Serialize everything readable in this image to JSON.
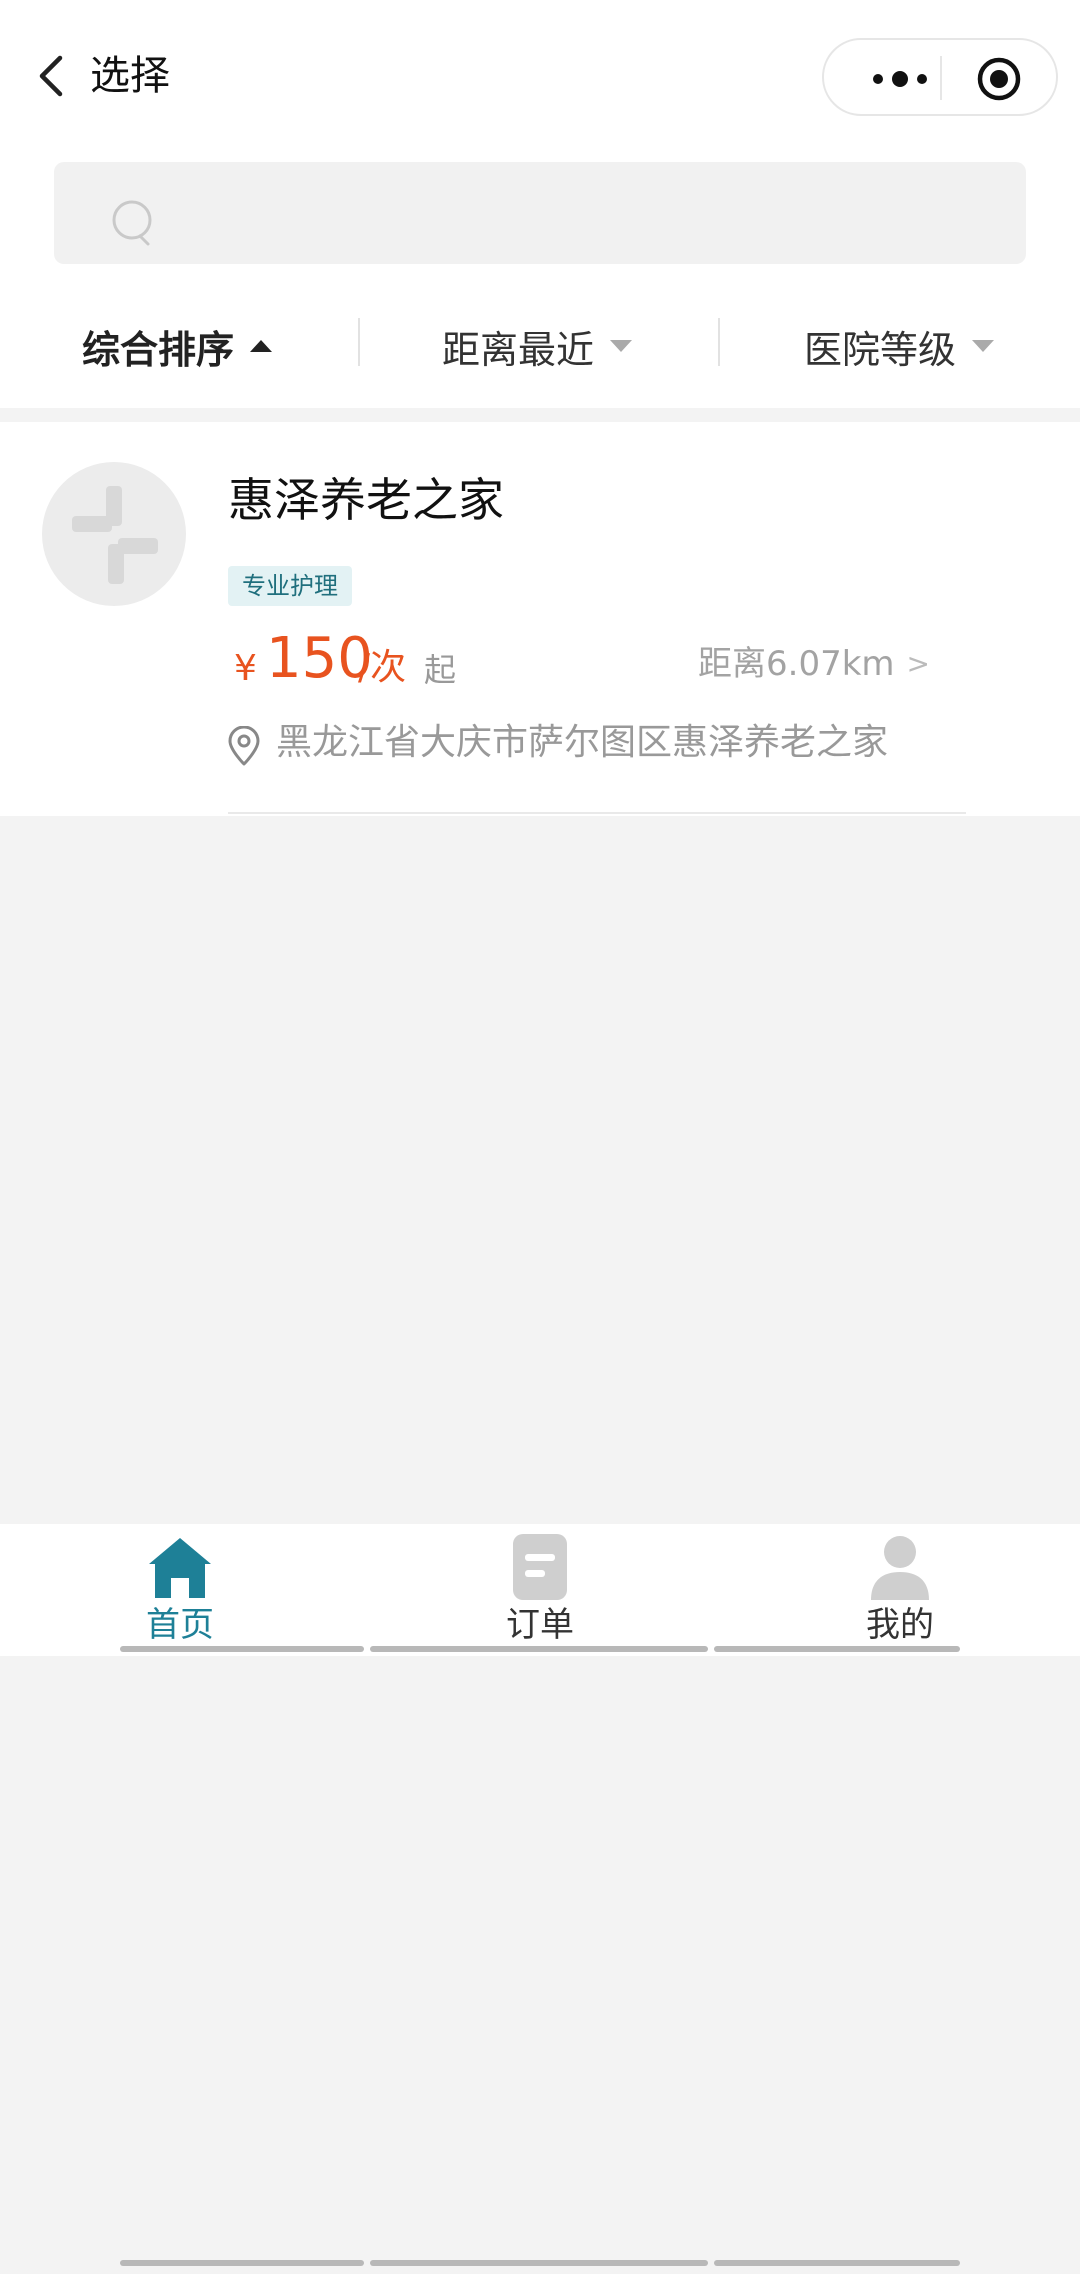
{
  "header": {
    "title": "选择",
    "back_icon": "chevron-left-icon",
    "capsule_icons": [
      "more-dots-icon",
      "target-icon"
    ]
  },
  "search": {
    "placeholder": "",
    "icon": "search-icon"
  },
  "filters": [
    {
      "label": "综合排序",
      "active": true,
      "arrow": "up"
    },
    {
      "label": "距离最近",
      "active": false,
      "arrow": "down"
    },
    {
      "label": "医院等级",
      "active": false,
      "arrow": "down"
    }
  ],
  "institutions": [
    {
      "name": "惠泽养老之家",
      "tag": "专业护理",
      "currency": "¥",
      "price": "150",
      "unit": "/次",
      "from": "起",
      "distance": "距离6.07km",
      "distance_chevron": ">",
      "address": "黑龙江省大庆市萨尔图区惠泽养老之家"
    }
  ],
  "tabbar": {
    "items": [
      {
        "label": "首页",
        "icon": "home-icon",
        "active": true
      },
      {
        "label": "订单",
        "icon": "order-icon",
        "active": false
      },
      {
        "label": "我的",
        "icon": "user-icon",
        "active": false
      }
    ]
  },
  "colors": {
    "accent": "#1e8097",
    "price": "#e8531f",
    "tag_bg": "#e3f2f4",
    "tag_text": "#1f6f7d",
    "background": "#f3f3f3"
  }
}
